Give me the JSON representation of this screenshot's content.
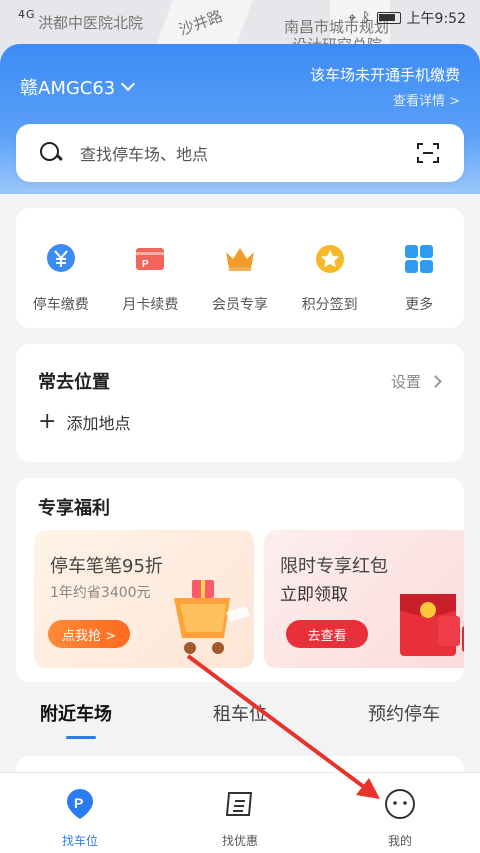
{
  "status_bar": {
    "network": "4G",
    "time": "上午9:52"
  },
  "map": {
    "labels": [
      "洪都中医院北院",
      "沙井路",
      "南昌市城市规划",
      "设计研究总院"
    ]
  },
  "header": {
    "plate": "赣AMGC63",
    "notice": "该车场未开通手机缴费",
    "detail": "查看详情 >"
  },
  "search": {
    "placeholder": "查找停车场、地点"
  },
  "quick_actions": [
    {
      "label": "停车缴费",
      "icon": "yuan-icon",
      "color": "#3d8bf5"
    },
    {
      "label": "月卡续费",
      "icon": "card-icon",
      "color": "#f2665a"
    },
    {
      "label": "会员专享",
      "icon": "crown-icon",
      "color": "#f39a2b"
    },
    {
      "label": "积分签到",
      "icon": "star-icon",
      "color": "#f7b928"
    },
    {
      "label": "更多",
      "icon": "grid-icon",
      "color": "#2f9cf3"
    }
  ],
  "frequent": {
    "title": "常去位置",
    "settings": "设置",
    "add": "添加地点"
  },
  "benefits": {
    "title": "专享福利",
    "promos": [
      {
        "headline": "停车笔笔95折",
        "sub": "1年约省3400元",
        "button": "点我抢 >"
      },
      {
        "headline": "限时专享红包",
        "sub": "立即领取",
        "button": "去查看"
      }
    ]
  },
  "tabs": [
    {
      "label": "附近车场",
      "active": true
    },
    {
      "label": "租车位",
      "active": false
    },
    {
      "label": "预约停车",
      "active": false
    }
  ],
  "bottom_nav": [
    {
      "label": "找车位",
      "active": true
    },
    {
      "label": "找优惠",
      "active": false
    },
    {
      "label": "我的",
      "active": false
    }
  ],
  "colors": {
    "accent": "#2b7cf0",
    "header": "#3d8bf5",
    "arrow": "#e8332a"
  }
}
